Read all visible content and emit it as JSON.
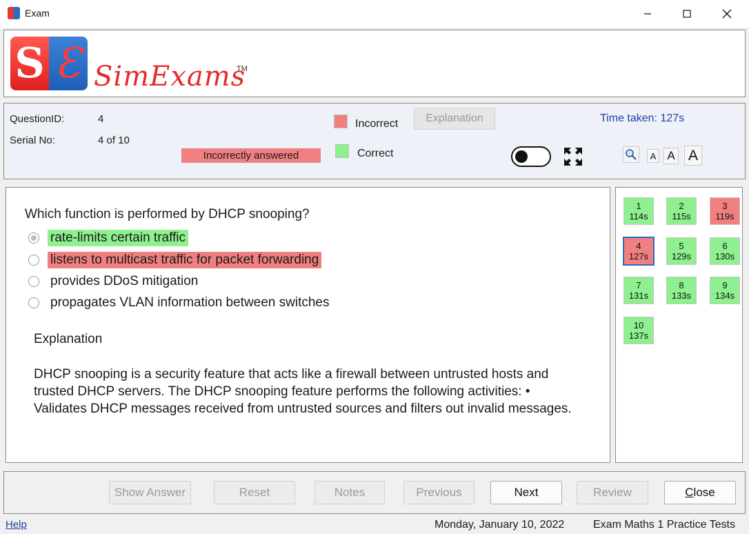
{
  "window": {
    "title": "Exam"
  },
  "logo": {
    "letter_s": "S",
    "letter_e": "Ɛ",
    "word": "SimExams",
    "tm": "TM"
  },
  "info": {
    "question_id_label": "QuestionID:",
    "question_id_value": "4",
    "serial_label": "Serial No:",
    "serial_value": "4 of 10",
    "status_text": "Incorrectly answered",
    "legend_incorrect": "Incorrect",
    "legend_correct": "Correct",
    "explanation_button": "Explanation",
    "time_label": "Time taken:",
    "time_value": "127s",
    "font_small": "A",
    "font_medium": "A",
    "font_large": "A",
    "colors": {
      "incorrect": "#f07f7f",
      "correct": "#8ef08e"
    }
  },
  "question": {
    "text": "Which function is performed by DHCP snooping?",
    "options": [
      {
        "label": "rate-limits certain traffic",
        "state": "correct",
        "selected": true
      },
      {
        "label": "listens to multicast traffic for packet forwarding",
        "state": "incorrect",
        "selected": false
      },
      {
        "label": "provides DDoS mitigation",
        "state": "none",
        "selected": false
      },
      {
        "label": "propagates VLAN information between switches",
        "state": "none",
        "selected": false
      }
    ],
    "explanation_title": "Explanation",
    "explanation_body": "DHCP snooping is a security feature that acts like a firewall between untrusted hosts and trusted DHCP servers. The DHCP snooping feature performs the following activities: • Validates DHCP messages received from untrusted sources and filters out invalid messages."
  },
  "grid": [
    {
      "num": "1",
      "time": "114s",
      "status": "correct"
    },
    {
      "num": "2",
      "time": "115s",
      "status": "correct"
    },
    {
      "num": "3",
      "time": "119s",
      "status": "incorrect"
    },
    {
      "num": "4",
      "time": "127s",
      "status": "incorrect",
      "current": true
    },
    {
      "num": "5",
      "time": "129s",
      "status": "correct"
    },
    {
      "num": "6",
      "time": "130s",
      "status": "correct"
    },
    {
      "num": "7",
      "time": "131s",
      "status": "correct"
    },
    {
      "num": "8",
      "time": "133s",
      "status": "correct"
    },
    {
      "num": "9",
      "time": "134s",
      "status": "correct"
    },
    {
      "num": "10",
      "time": "137s",
      "status": "correct"
    }
  ],
  "buttons": {
    "show_answer": "Show Answer",
    "reset": "Reset",
    "notes": "Notes",
    "previous": "Previous",
    "next": "Next",
    "review": "Review",
    "close_first": "C",
    "close_rest": "lose"
  },
  "status_bar": {
    "help": "Help",
    "date": "Monday, January 10, 2022",
    "product": "Exam Maths 1 Practice Tests"
  }
}
